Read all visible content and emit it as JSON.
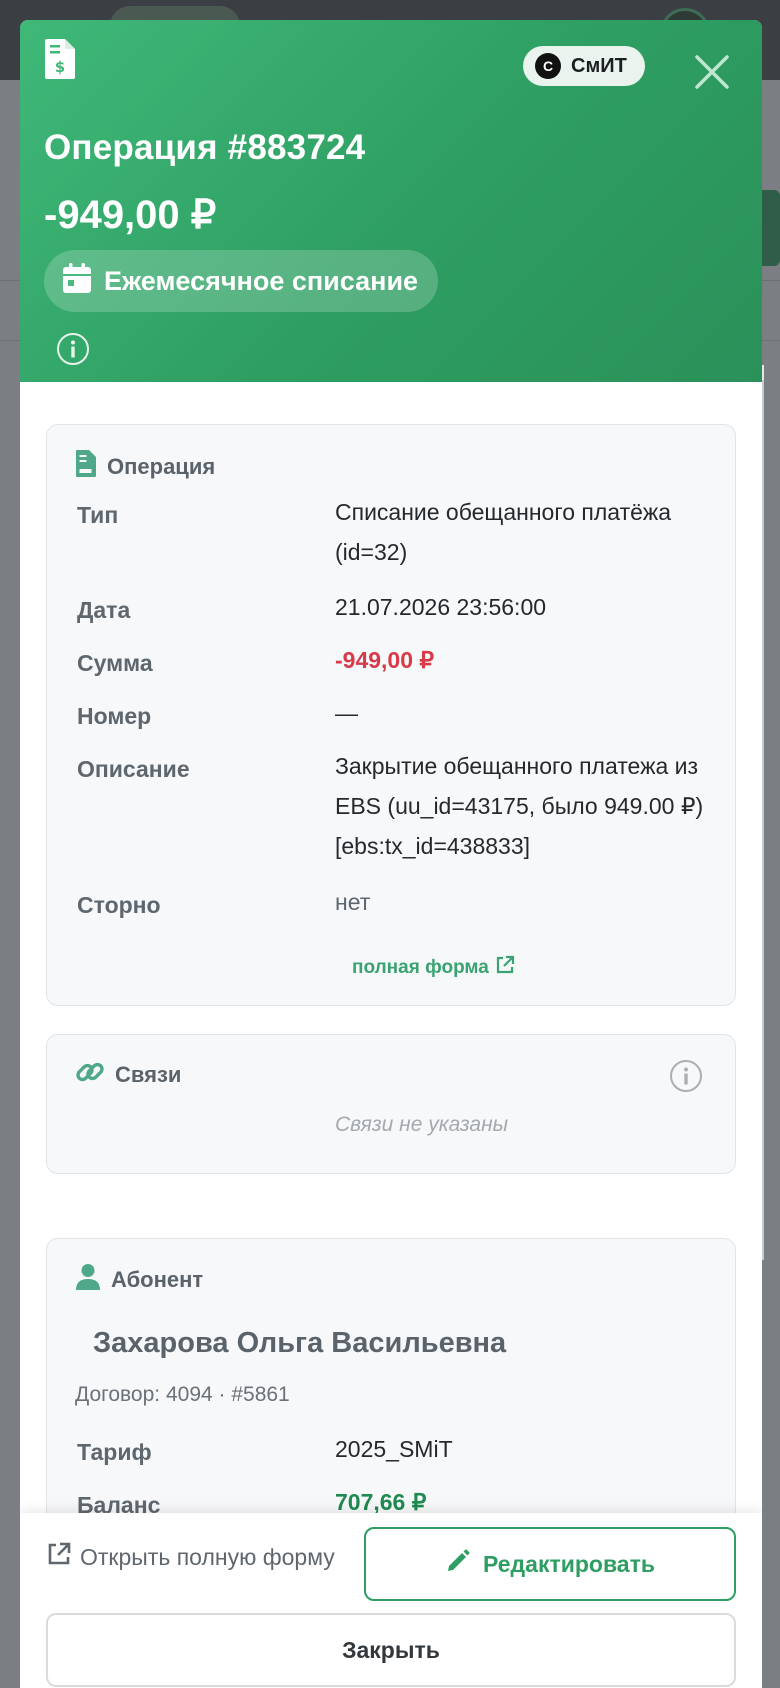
{
  "header": {
    "badge_logo": "С",
    "badge_label": "СмИТ",
    "title": "Операция #883724",
    "amount": "-949,00 ₽",
    "period_label": "Ежемесячное списание",
    "colors": {
      "primary": "#2e9e62",
      "header_start": "#3fb878"
    }
  },
  "operation": {
    "title": "Операция",
    "rows": [
      {
        "label": "Тип",
        "value": "Списание обещанного платёжа (id=32)"
      },
      {
        "label": "Дата",
        "value": "21.07.2026 23:56:00"
      },
      {
        "label": "Сумма",
        "value": "-949,00 ₽"
      },
      {
        "label": "Номер",
        "value": "—"
      },
      {
        "label": "Описание",
        "value": "Закрытие обещанного платежа из EBS (uu_id=43175, было 949.00 ₽) [ebs:tx_id=438833]"
      },
      {
        "label": "Сторно",
        "value": "нет"
      }
    ],
    "full_form_link": "полная форма"
  },
  "links": {
    "title": "Связи",
    "empty": "Связи не указаны"
  },
  "subscriber": {
    "title": "Абонент",
    "name": "Захарова Ольга Васильевна",
    "contract": "Договор: 4094 · #5861",
    "rows": [
      {
        "label": "Тариф",
        "value": "2025_SMiT"
      },
      {
        "label": "Баланс",
        "value": "707,66 ₽"
      }
    ]
  },
  "footer": {
    "open_full": "Открыть полную форму",
    "edit": "Редактировать",
    "close": "Закрыть"
  }
}
